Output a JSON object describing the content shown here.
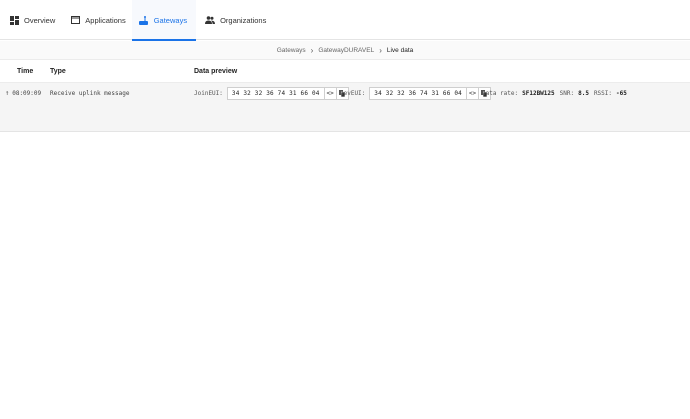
{
  "nav": {
    "tabs": [
      {
        "label": "Overview",
        "icon": "grid-icon"
      },
      {
        "label": "Applications",
        "icon": "window-icon"
      },
      {
        "label": "Gateways",
        "icon": "gateway-icon",
        "active": true
      },
      {
        "label": "Organizations",
        "icon": "people-icon"
      }
    ]
  },
  "breadcrumb": [
    "Gateways",
    "GatewayDURAVEL",
    "Live data"
  ],
  "table": {
    "headers": {
      "time": "Time",
      "type": "Type",
      "preview": "Data preview"
    },
    "rows": [
      {
        "time": "08:09:09",
        "type": "Receive uplink message",
        "join_eui_label": "JoinEUI:",
        "join_eui": "34 32 32 36 74 31 66 04",
        "dev_eui_label": "DevEUI:",
        "dev_eui": "34 32 32 36 74 31 66 04",
        "data_rate_label": "Data rate:",
        "data_rate": "SF12BW125",
        "snr_label": "SNR:",
        "snr": "8.5",
        "rssi_label": "RSSI:",
        "rssi": "-65"
      }
    ]
  },
  "colors": {
    "accent": "#1a73e8"
  }
}
